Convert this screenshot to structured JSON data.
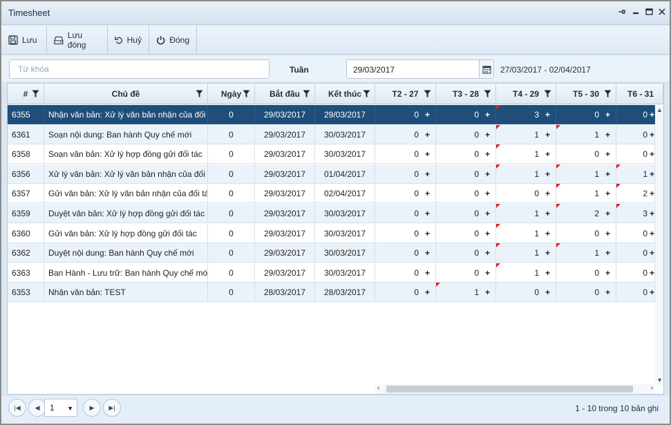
{
  "window": {
    "title": "Timesheet",
    "controls": [
      "pin-icon",
      "minimize-icon",
      "maximize-icon",
      "close-icon"
    ]
  },
  "toolbar": {
    "save_label": "Lưu",
    "save_close_label": "Lưu đóng",
    "cancel_label": "Huỷ",
    "close_label": "Đóng"
  },
  "search": {
    "placeholder": "Từ khóa",
    "value": ""
  },
  "week": {
    "label": "Tuần",
    "date": "29/03/2017",
    "range": "27/03/2017 - 02/04/2017"
  },
  "columns": {
    "id": "#",
    "subject": "Chủ đề",
    "days": "Ngày",
    "start": "Bắt đầu",
    "end": "Kết thúc",
    "d1": "T2 - 27",
    "d2": "T3 - 28",
    "d3": "T4 - 29",
    "d4": "T5 - 30",
    "d5": "T6 - 31"
  },
  "rows": [
    {
      "id": "6355",
      "subject": "Nhận văn bản: Xử lý văn bản nhận của đối tác",
      "days": "0",
      "start": "29/03/2017",
      "end": "29/03/2017",
      "d1": "0",
      "d2": "0",
      "d3": "3",
      "d4": "0",
      "d5": "0"
    },
    {
      "id": "6361",
      "subject": "Soạn nội dung: Ban hành Quy chế mới",
      "days": "0",
      "start": "29/03/2017",
      "end": "30/03/2017",
      "d1": "0",
      "d2": "0",
      "d3": "1",
      "d4": "1",
      "d5": "0"
    },
    {
      "id": "6358",
      "subject": "Soạn văn bản: Xử lý hợp đồng gửi đối tác",
      "days": "0",
      "start": "29/03/2017",
      "end": "30/03/2017",
      "d1": "0",
      "d2": "0",
      "d3": "1",
      "d4": "0",
      "d5": "0"
    },
    {
      "id": "6356",
      "subject": "Xử lý văn bản: Xử lý văn bản nhận của đối tác",
      "days": "0",
      "start": "29/03/2017",
      "end": "01/04/2017",
      "d1": "0",
      "d2": "0",
      "d3": "1",
      "d4": "1",
      "d5": "1"
    },
    {
      "id": "6357",
      "subject": "Gửi văn bản: Xử lý văn bản nhận của đối tác",
      "days": "0",
      "start": "29/03/2017",
      "end": "02/04/2017",
      "d1": "0",
      "d2": "0",
      "d3": "0",
      "d4": "1",
      "d5": "2"
    },
    {
      "id": "6359",
      "subject": "Duyệt văn bản: Xử lý hợp đồng gửi đối tác",
      "days": "0",
      "start": "29/03/2017",
      "end": "30/03/2017",
      "d1": "0",
      "d2": "0",
      "d3": "1",
      "d4": "2",
      "d5": "3"
    },
    {
      "id": "6360",
      "subject": "Gửi văn bản: Xử lý hợp đồng gửi đối tác",
      "days": "0",
      "start": "29/03/2017",
      "end": "30/03/2017",
      "d1": "0",
      "d2": "0",
      "d3": "1",
      "d4": "0",
      "d5": "0"
    },
    {
      "id": "6362",
      "subject": "Duyệt nội dung: Ban hành Quy chế mới",
      "days": "0",
      "start": "29/03/2017",
      "end": "30/03/2017",
      "d1": "0",
      "d2": "0",
      "d3": "1",
      "d4": "1",
      "d5": "0"
    },
    {
      "id": "6363",
      "subject": "Ban Hành - Lưu trữ: Ban hành Quy chế mới",
      "days": "0",
      "start": "29/03/2017",
      "end": "30/03/2017",
      "d1": "0",
      "d2": "0",
      "d3": "1",
      "d4": "0",
      "d5": "0"
    },
    {
      "id": "6353",
      "subject": "Nhận văn bản: TEST",
      "days": "0",
      "start": "28/03/2017",
      "end": "28/03/2017",
      "d1": "0",
      "d2": "1",
      "d3": "0",
      "d4": "0",
      "d5": "0"
    }
  ],
  "flags": {
    "6355": [
      "d3"
    ],
    "6361": [
      "d3",
      "d4"
    ],
    "6358": [
      "d3"
    ],
    "6356": [
      "d3",
      "d4",
      "d5"
    ],
    "6357": [
      "d4",
      "d5"
    ],
    "6359": [
      "d3",
      "d4",
      "d5"
    ],
    "6360": [
      "d3"
    ],
    "6362": [
      "d3",
      "d4"
    ],
    "6363": [
      "d3"
    ],
    "6353": [
      "d2"
    ]
  },
  "selected_row": "6355",
  "pager": {
    "page": "1",
    "info": "1 - 10 trong 10 bản ghi"
  },
  "colors": {
    "selected": "#1f4e7a",
    "flag": "#e12020",
    "alt_row": "#eaf2fa"
  }
}
